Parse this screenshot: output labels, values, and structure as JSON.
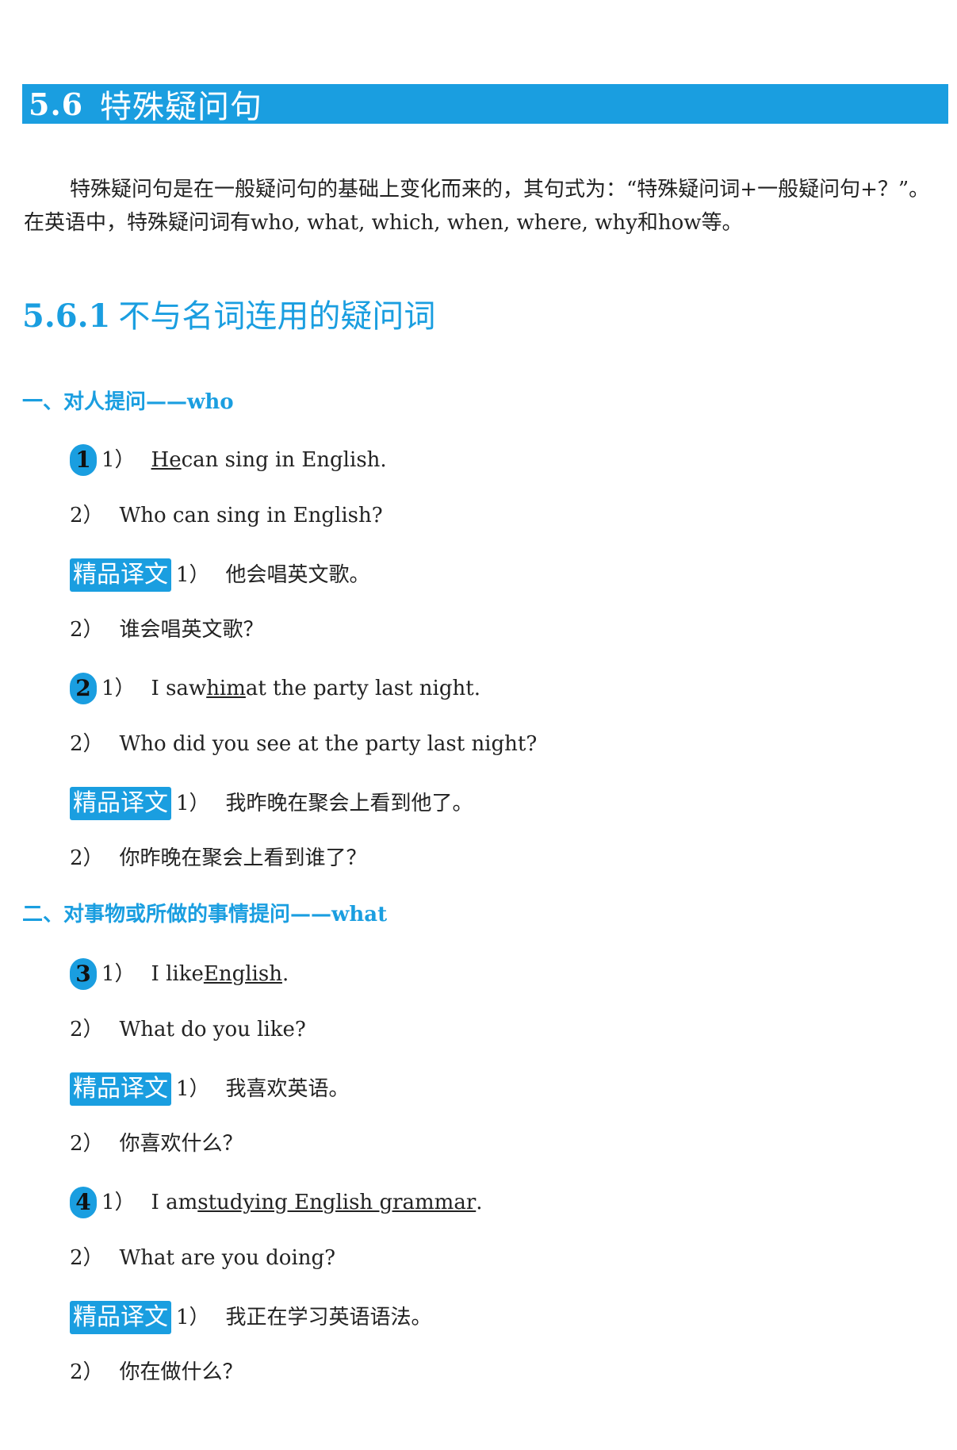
{
  "section": {
    "number": "5.6",
    "title": "特殊疑问句"
  },
  "intro": "特殊疑问句是在一般疑问句的基础上变化而来的，其句式为：“特殊疑问词+一般疑问句+？”。在英语中，特殊疑问词有who, what, which, when, where, why和how等。",
  "subsection": {
    "number": "5.6.1",
    "title": "不与名词连用的疑问词"
  },
  "translation_badge": "精品译文",
  "categories": [
    {
      "prefix": "一、对人提问——",
      "keyword": "who"
    },
    {
      "prefix": "二、对事物或所做的事情提问——",
      "keyword": "what"
    }
  ],
  "examples": [
    {
      "number": "1",
      "s1_marker": "1）",
      "s1_pre": "",
      "s1_u": "He",
      "s1_post": " can sing in English.",
      "s2_marker": "2）",
      "s2": "Who can sing in English?",
      "t1_marker": "1）",
      "t1": "他会唱英文歌。",
      "t2_marker": "2）",
      "t2": "谁会唱英文歌？"
    },
    {
      "number": "2",
      "s1_marker": "1）",
      "s1_pre": "I saw ",
      "s1_u": "him",
      "s1_post": " at the party last night.",
      "s2_marker": "2）",
      "s2": "Who did you see at the party last night?",
      "t1_marker": "1）",
      "t1": "我昨晚在聚会上看到他了。",
      "t2_marker": "2）",
      "t2": "你昨晚在聚会上看到谁了？"
    },
    {
      "number": "3",
      "s1_marker": "1）",
      "s1_pre": "I like ",
      "s1_u": "English",
      "s1_post": ".",
      "s2_marker": "2）",
      "s2": "What do you like?",
      "t1_marker": "1）",
      "t1": "我喜欢英语。",
      "t2_marker": "2）",
      "t2": "你喜欢什么？"
    },
    {
      "number": "4",
      "s1_marker": "1）",
      "s1_pre": "I am ",
      "s1_u": "studying English grammar",
      "s1_post": ".",
      "s2_marker": "2）",
      "s2": "What are you doing?",
      "t1_marker": "1）",
      "t1": "我正在学习英语语法。",
      "t2_marker": "2）",
      "t2": "你在做什么？"
    }
  ]
}
